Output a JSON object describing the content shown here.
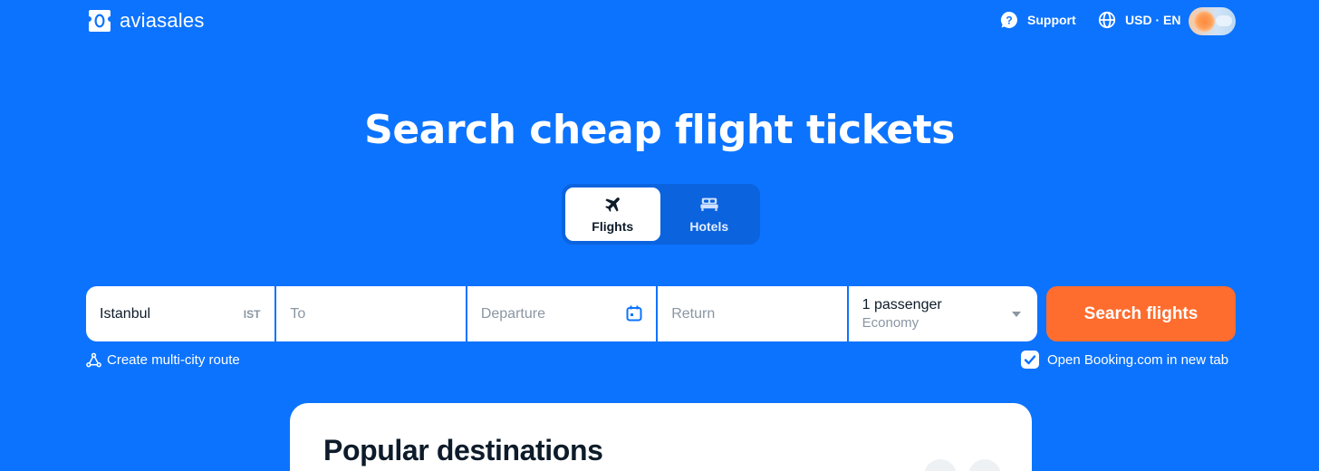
{
  "header": {
    "brand": "aviasales",
    "support_label": "Support",
    "locale_label": "USD · EN"
  },
  "hero": {
    "title": "Search cheap flight tickets"
  },
  "tabs": [
    {
      "label": "Flights",
      "active": true
    },
    {
      "label": "Hotels",
      "active": false
    }
  ],
  "search": {
    "origin_value": "Istanbul",
    "origin_code": "IST",
    "destination_placeholder": "To",
    "departure_placeholder": "Departure",
    "return_placeholder": "Return",
    "passengers": "1 passenger",
    "cabin_class": "Economy",
    "submit_label": "Search flights"
  },
  "options": {
    "multi_city_label": "Create multi-city route",
    "open_booking_label": "Open Booking.com in new tab",
    "open_booking_checked": true
  },
  "popular": {
    "title": "Popular destinations"
  },
  "colors": {
    "background": "#0c73fe",
    "accent_button": "#ff6d2e",
    "tabs_bg": "#0b63de"
  },
  "icons": [
    "logo-icon",
    "support-icon",
    "globe-icon",
    "plane-icon",
    "bed-icon",
    "calendar-icon",
    "route-icon",
    "checkmark-icon",
    "chevron-down-icon"
  ]
}
